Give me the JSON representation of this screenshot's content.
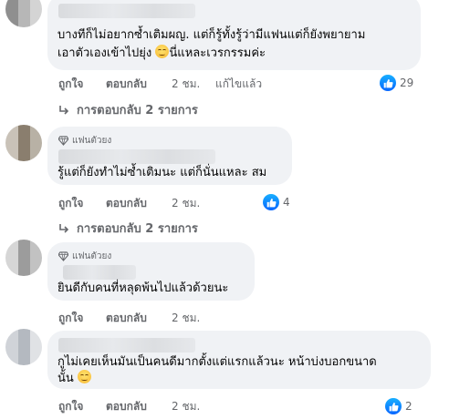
{
  "comments": [
    {
      "text_lines": [
        "บางทีก็ไม่อยากซ้ำเติมผญ. แต่ก็รู้ทั้งรู้ว่ามีแฟนแต่ก็ยังพยายาม",
        "เอาตัวเองเข้าไปยุ่ง",
        "นี่แหละเวรกรรมค่ะ"
      ],
      "emoji": "grinning-sweat-emoji",
      "actions": {
        "like": "ถูกใจ",
        "reply": "ตอบกลับ",
        "time": "2 ชม.",
        "edited": "แก้ไขแล้ว"
      },
      "reaction_count": "29",
      "replies_label": "การตอบกลับ 2 รายการ"
    },
    {
      "badge": "แฟนตัวยง",
      "text_lines": [
        "รู้แต่ก็ยังทำไม่ซ้ำเติมนะ แต่ก็นั่นแหละ สม"
      ],
      "actions": {
        "like": "ถูกใจ",
        "reply": "ตอบกลับ",
        "time": "2 ชม."
      },
      "reaction_count": "4",
      "replies_label": "การตอบกลับ 2 รายการ"
    },
    {
      "badge": "แฟนตัวยง",
      "text_lines": [
        "ยินดีกับคนที่หลุดพ้นไปแล้วด้วยนะ"
      ],
      "actions": {
        "like": "ถูกใจ",
        "reply": "ตอบกลับ",
        "time": "2 ชม."
      }
    },
    {
      "text_lines": [
        "กูไม่เคยเห็นมันเป็นคนดีมากตั้งแต่แรกแล้วนะ หน้าบ่งบอกขนาด",
        "นั้น"
      ],
      "emoji": "grinning-sweat-emoji",
      "actions": {
        "like": "ถูกใจ",
        "reply": "ตอบกลับ",
        "time": "2 ชม."
      },
      "reaction_count": "2"
    }
  ],
  "colors": {
    "bubble": "#f0f2f5",
    "secondary_text": "#65676b",
    "like_blue": "#0866ff"
  },
  "icons": {
    "reaction": "like-icon",
    "badge": "diamond-icon",
    "reply_arrow": "reply-arrow-icon"
  }
}
